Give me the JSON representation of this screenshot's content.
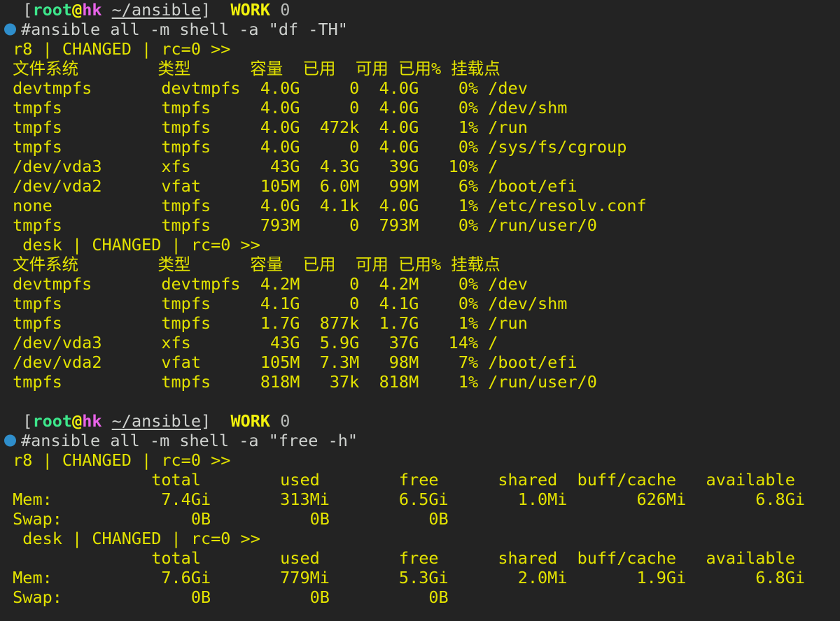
{
  "terminal": {
    "background_color": "#232323",
    "output_color": "#e3e300",
    "command_color": "#cfd2cf",
    "bullet_color": "#2f8ecb",
    "user_color": "#3de68b",
    "host_color": "#e863e8",
    "at_color": "#f2f20d"
  },
  "prompt": {
    "bracket_open": "[",
    "user": "root",
    "at": "@",
    "host": "hk",
    "path": "~/ansible",
    "bracket_close": "]",
    "work_label": "WORK",
    "exit_code": "0"
  },
  "blocks": [
    {
      "command": "#ansible all -m shell -a \"df -TH\"",
      "results": [
        {
          "header": " r8 | CHANGED | rc=0 >>",
          "table_header": " 文件系统        类型      容量  已用  可用 已用% 挂载点",
          "rows": [
            " devtmpfs       devtmpfs  4.0G     0  4.0G    0% /dev",
            " tmpfs          tmpfs     4.0G     0  4.0G    0% /dev/shm",
            " tmpfs          tmpfs     4.0G  472k  4.0G    1% /run",
            " tmpfs          tmpfs     4.0G     0  4.0G    0% /sys/fs/cgroup",
            " /dev/vda3      xfs        43G  4.3G   39G   10% /",
            " /dev/vda2      vfat      105M  6.0M   99M    6% /boot/efi",
            " none           tmpfs     4.0G  4.1k  4.0G    1% /etc/resolv.conf",
            " tmpfs          tmpfs     793M     0  793M    0% /run/user/0"
          ]
        },
        {
          "header": "  desk | CHANGED | rc=0 >>",
          "table_header": " 文件系统        类型      容量  已用  可用 已用% 挂载点",
          "rows": [
            " devtmpfs       devtmpfs  4.2M     0  4.2M    0% /dev",
            " tmpfs          tmpfs     4.1G     0  4.1G    0% /dev/shm",
            " tmpfs          tmpfs     1.7G  877k  1.7G    1% /run",
            " /dev/vda3      xfs        43G  5.9G   37G   14% /",
            " /dev/vda2      vfat      105M  7.3M   98M    7% /boot/efi",
            " tmpfs          tmpfs     818M   37k  818M    1% /run/user/0"
          ]
        }
      ]
    },
    {
      "command": "#ansible all -m shell -a \"free -h\"",
      "results": [
        {
          "header": " r8 | CHANGED | rc=0 >>",
          "table_header": "               total        used        free      shared  buff/cache   available",
          "rows": [
            " Mem:           7.4Gi       313Mi       6.5Gi       1.0Mi       626Mi       6.8Gi",
            " Swap:             0B          0B          0B"
          ]
        },
        {
          "header": "  desk | CHANGED | rc=0 >>",
          "table_header": "               total        used        free      shared  buff/cache   available",
          "rows": [
            " Mem:           7.6Gi       779Mi       5.3Gi       2.0Mi       1.9Gi       6.8Gi",
            " Swap:             0B          0B          0B"
          ]
        }
      ]
    }
  ]
}
